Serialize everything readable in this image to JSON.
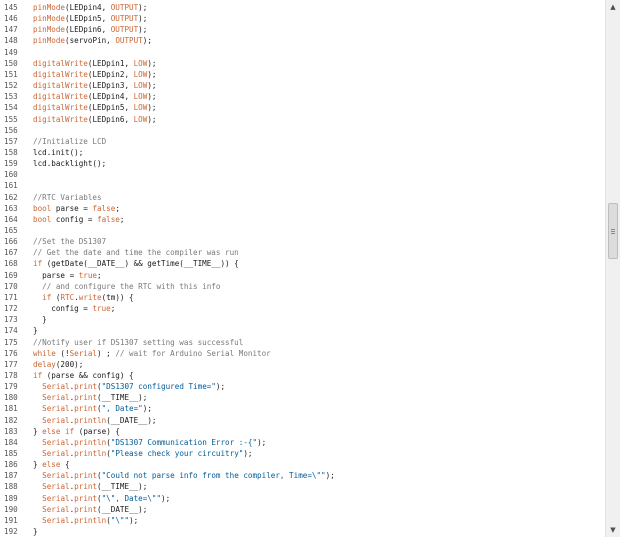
{
  "colors": {
    "keyword": "#cc6633",
    "string": "#005c99",
    "comment": "#7a7a7a",
    "text": "#1a1a1a",
    "line_number": "#555555"
  },
  "scrollbar": {
    "up_icon": "▲",
    "down_icon": "▼"
  },
  "lines": [
    {
      "n": "145",
      "tokens": [
        {
          "t": "pinMode",
          "c": "orange"
        },
        {
          "t": "(LEDpin4, ",
          "c": "plain"
        },
        {
          "t": "OUTPUT",
          "c": "orange"
        },
        {
          "t": ");",
          "c": "plain"
        }
      ]
    },
    {
      "n": "146",
      "tokens": [
        {
          "t": "pinMode",
          "c": "orange"
        },
        {
          "t": "(LEDpin5, ",
          "c": "plain"
        },
        {
          "t": "OUTPUT",
          "c": "orange"
        },
        {
          "t": ");",
          "c": "plain"
        }
      ]
    },
    {
      "n": "147",
      "tokens": [
        {
          "t": "pinMode",
          "c": "orange"
        },
        {
          "t": "(LEDpin6, ",
          "c": "plain"
        },
        {
          "t": "OUTPUT",
          "c": "orange"
        },
        {
          "t": ");",
          "c": "plain"
        }
      ]
    },
    {
      "n": "148",
      "tokens": [
        {
          "t": "pinMode",
          "c": "orange"
        },
        {
          "t": "(servoPin, ",
          "c": "plain"
        },
        {
          "t": "OUTPUT",
          "c": "orange"
        },
        {
          "t": ");",
          "c": "plain"
        }
      ]
    },
    {
      "n": "149",
      "tokens": []
    },
    {
      "n": "150",
      "tokens": [
        {
          "t": "digitalWrite",
          "c": "orange"
        },
        {
          "t": "(LEDpin1, ",
          "c": "plain"
        },
        {
          "t": "LOW",
          "c": "orange"
        },
        {
          "t": ");",
          "c": "plain"
        }
      ]
    },
    {
      "n": "151",
      "tokens": [
        {
          "t": "digitalWrite",
          "c": "orange"
        },
        {
          "t": "(LEDpin2, ",
          "c": "plain"
        },
        {
          "t": "LOW",
          "c": "orange"
        },
        {
          "t": ");",
          "c": "plain"
        }
      ]
    },
    {
      "n": "152",
      "tokens": [
        {
          "t": "digitalWrite",
          "c": "orange"
        },
        {
          "t": "(LEDpin3, ",
          "c": "plain"
        },
        {
          "t": "LOW",
          "c": "orange"
        },
        {
          "t": ");",
          "c": "plain"
        }
      ]
    },
    {
      "n": "153",
      "tokens": [
        {
          "t": "digitalWrite",
          "c": "orange"
        },
        {
          "t": "(LEDpin4, ",
          "c": "plain"
        },
        {
          "t": "LOW",
          "c": "orange"
        },
        {
          "t": ");",
          "c": "plain"
        }
      ]
    },
    {
      "n": "154",
      "tokens": [
        {
          "t": "digitalWrite",
          "c": "orange"
        },
        {
          "t": "(LEDpin5, ",
          "c": "plain"
        },
        {
          "t": "LOW",
          "c": "orange"
        },
        {
          "t": ");",
          "c": "plain"
        }
      ]
    },
    {
      "n": "155",
      "tokens": [
        {
          "t": "digitalWrite",
          "c": "orange"
        },
        {
          "t": "(LEDpin6, ",
          "c": "plain"
        },
        {
          "t": "LOW",
          "c": "orange"
        },
        {
          "t": ");",
          "c": "plain"
        }
      ]
    },
    {
      "n": "156",
      "tokens": []
    },
    {
      "n": "157",
      "tokens": [
        {
          "t": "//Initialize LCD",
          "c": "com"
        }
      ]
    },
    {
      "n": "158",
      "tokens": [
        {
          "t": "lcd.init();",
          "c": "plain"
        }
      ]
    },
    {
      "n": "159",
      "tokens": [
        {
          "t": "lcd.backlight();",
          "c": "plain"
        }
      ]
    },
    {
      "n": "160",
      "tokens": []
    },
    {
      "n": "161",
      "tokens": []
    },
    {
      "n": "162",
      "tokens": [
        {
          "t": "//RTC Variables",
          "c": "com"
        }
      ]
    },
    {
      "n": "163",
      "tokens": [
        {
          "t": "bool",
          "c": "orange"
        },
        {
          "t": " parse = ",
          "c": "plain"
        },
        {
          "t": "false",
          "c": "orange"
        },
        {
          "t": ";",
          "c": "plain"
        }
      ]
    },
    {
      "n": "164",
      "tokens": [
        {
          "t": "bool",
          "c": "orange"
        },
        {
          "t": " config = ",
          "c": "plain"
        },
        {
          "t": "false",
          "c": "orange"
        },
        {
          "t": ";",
          "c": "plain"
        }
      ]
    },
    {
      "n": "165",
      "tokens": []
    },
    {
      "n": "166",
      "tokens": [
        {
          "t": "//Set the DS1307",
          "c": "com"
        }
      ]
    },
    {
      "n": "167",
      "tokens": [
        {
          "t": "// Get the date and time the compiler was run",
          "c": "com"
        }
      ]
    },
    {
      "n": "168",
      "tokens": [
        {
          "t": "if",
          "c": "orange"
        },
        {
          "t": " (getDate(__DATE__) && getTime(__TIME__)) {",
          "c": "plain"
        }
      ]
    },
    {
      "n": "169",
      "tokens": [
        {
          "t": "  parse = ",
          "c": "plain"
        },
        {
          "t": "true",
          "c": "orange"
        },
        {
          "t": ";",
          "c": "plain"
        }
      ]
    },
    {
      "n": "170",
      "tokens": [
        {
          "t": "  // and configure the RTC with this info",
          "c": "com"
        }
      ]
    },
    {
      "n": "171",
      "tokens": [
        {
          "t": "  ",
          "c": "plain"
        },
        {
          "t": "if",
          "c": "orange"
        },
        {
          "t": " (",
          "c": "plain"
        },
        {
          "t": "RTC",
          "c": "orange"
        },
        {
          "t": ".",
          "c": "plain"
        },
        {
          "t": "write",
          "c": "orange"
        },
        {
          "t": "(tm)) {",
          "c": "plain"
        }
      ]
    },
    {
      "n": "172",
      "tokens": [
        {
          "t": "    config = ",
          "c": "plain"
        },
        {
          "t": "true",
          "c": "orange"
        },
        {
          "t": ";",
          "c": "plain"
        }
      ]
    },
    {
      "n": "173",
      "tokens": [
        {
          "t": "  }",
          "c": "plain"
        }
      ]
    },
    {
      "n": "174",
      "tokens": [
        {
          "t": "}",
          "c": "plain"
        }
      ]
    },
    {
      "n": "175",
      "tokens": [
        {
          "t": "//Notify user if DS1307 setting was successful",
          "c": "com"
        }
      ]
    },
    {
      "n": "176",
      "tokens": [
        {
          "t": "while",
          "c": "orange"
        },
        {
          "t": " (!",
          "c": "plain"
        },
        {
          "t": "Serial",
          "c": "orange"
        },
        {
          "t": ") ; ",
          "c": "plain"
        },
        {
          "t": "// wait for Arduino Serial Monitor",
          "c": "com"
        }
      ]
    },
    {
      "n": "177",
      "tokens": [
        {
          "t": "delay",
          "c": "orange"
        },
        {
          "t": "(200);",
          "c": "plain"
        }
      ]
    },
    {
      "n": "178",
      "tokens": [
        {
          "t": "if",
          "c": "orange"
        },
        {
          "t": " (parse && config) {",
          "c": "plain"
        }
      ]
    },
    {
      "n": "179",
      "tokens": [
        {
          "t": "  ",
          "c": "plain"
        },
        {
          "t": "Serial",
          "c": "orange"
        },
        {
          "t": ".",
          "c": "plain"
        },
        {
          "t": "print",
          "c": "orange"
        },
        {
          "t": "(",
          "c": "plain"
        },
        {
          "t": "\"DS1307 configured Time=\"",
          "c": "str"
        },
        {
          "t": ");",
          "c": "plain"
        }
      ]
    },
    {
      "n": "180",
      "tokens": [
        {
          "t": "  ",
          "c": "plain"
        },
        {
          "t": "Serial",
          "c": "orange"
        },
        {
          "t": ".",
          "c": "plain"
        },
        {
          "t": "print",
          "c": "orange"
        },
        {
          "t": "(__TIME__);",
          "c": "plain"
        }
      ]
    },
    {
      "n": "181",
      "tokens": [
        {
          "t": "  ",
          "c": "plain"
        },
        {
          "t": "Serial",
          "c": "orange"
        },
        {
          "t": ".",
          "c": "plain"
        },
        {
          "t": "print",
          "c": "orange"
        },
        {
          "t": "(",
          "c": "plain"
        },
        {
          "t": "\", Date=\"",
          "c": "str"
        },
        {
          "t": ");",
          "c": "plain"
        }
      ]
    },
    {
      "n": "182",
      "tokens": [
        {
          "t": "  ",
          "c": "plain"
        },
        {
          "t": "Serial",
          "c": "orange"
        },
        {
          "t": ".",
          "c": "plain"
        },
        {
          "t": "println",
          "c": "orange"
        },
        {
          "t": "(__DATE__);",
          "c": "plain"
        }
      ]
    },
    {
      "n": "183",
      "tokens": [
        {
          "t": "} ",
          "c": "plain"
        },
        {
          "t": "else",
          "c": "orange"
        },
        {
          "t": " ",
          "c": "plain"
        },
        {
          "t": "if",
          "c": "orange"
        },
        {
          "t": " (parse) {",
          "c": "plain"
        }
      ]
    },
    {
      "n": "184",
      "tokens": [
        {
          "t": "  ",
          "c": "plain"
        },
        {
          "t": "Serial",
          "c": "orange"
        },
        {
          "t": ".",
          "c": "plain"
        },
        {
          "t": "println",
          "c": "orange"
        },
        {
          "t": "(",
          "c": "plain"
        },
        {
          "t": "\"DS1307 Communication Error :-{\"",
          "c": "str"
        },
        {
          "t": ");",
          "c": "plain"
        }
      ]
    },
    {
      "n": "185",
      "tokens": [
        {
          "t": "  ",
          "c": "plain"
        },
        {
          "t": "Serial",
          "c": "orange"
        },
        {
          "t": ".",
          "c": "plain"
        },
        {
          "t": "println",
          "c": "orange"
        },
        {
          "t": "(",
          "c": "plain"
        },
        {
          "t": "\"Please check your circuitry\"",
          "c": "str"
        },
        {
          "t": ");",
          "c": "plain"
        }
      ]
    },
    {
      "n": "186",
      "tokens": [
        {
          "t": "} ",
          "c": "plain"
        },
        {
          "t": "else",
          "c": "orange"
        },
        {
          "t": " {",
          "c": "plain"
        }
      ]
    },
    {
      "n": "187",
      "tokens": [
        {
          "t": "  ",
          "c": "plain"
        },
        {
          "t": "Serial",
          "c": "orange"
        },
        {
          "t": ".",
          "c": "plain"
        },
        {
          "t": "print",
          "c": "orange"
        },
        {
          "t": "(",
          "c": "plain"
        },
        {
          "t": "\"Could not parse info from the compiler, Time=\\\"\"",
          "c": "str"
        },
        {
          "t": ");",
          "c": "plain"
        }
      ]
    },
    {
      "n": "188",
      "tokens": [
        {
          "t": "  ",
          "c": "plain"
        },
        {
          "t": "Serial",
          "c": "orange"
        },
        {
          "t": ".",
          "c": "plain"
        },
        {
          "t": "print",
          "c": "orange"
        },
        {
          "t": "(__TIME__);",
          "c": "plain"
        }
      ]
    },
    {
      "n": "189",
      "tokens": [
        {
          "t": "  ",
          "c": "plain"
        },
        {
          "t": "Serial",
          "c": "orange"
        },
        {
          "t": ".",
          "c": "plain"
        },
        {
          "t": "print",
          "c": "orange"
        },
        {
          "t": "(",
          "c": "plain"
        },
        {
          "t": "\"\\\", Date=\\\"\"",
          "c": "str"
        },
        {
          "t": ");",
          "c": "plain"
        }
      ]
    },
    {
      "n": "190",
      "tokens": [
        {
          "t": "  ",
          "c": "plain"
        },
        {
          "t": "Serial",
          "c": "orange"
        },
        {
          "t": ".",
          "c": "plain"
        },
        {
          "t": "print",
          "c": "orange"
        },
        {
          "t": "(__DATE__);",
          "c": "plain"
        }
      ]
    },
    {
      "n": "191",
      "tokens": [
        {
          "t": "  ",
          "c": "plain"
        },
        {
          "t": "Serial",
          "c": "orange"
        },
        {
          "t": ".",
          "c": "plain"
        },
        {
          "t": "println",
          "c": "orange"
        },
        {
          "t": "(",
          "c": "plain"
        },
        {
          "t": "\"\\\"\"",
          "c": "str"
        },
        {
          "t": ");",
          "c": "plain"
        }
      ]
    },
    {
      "n": "192",
      "tokens": [
        {
          "t": "}",
          "c": "plain"
        }
      ]
    }
  ]
}
